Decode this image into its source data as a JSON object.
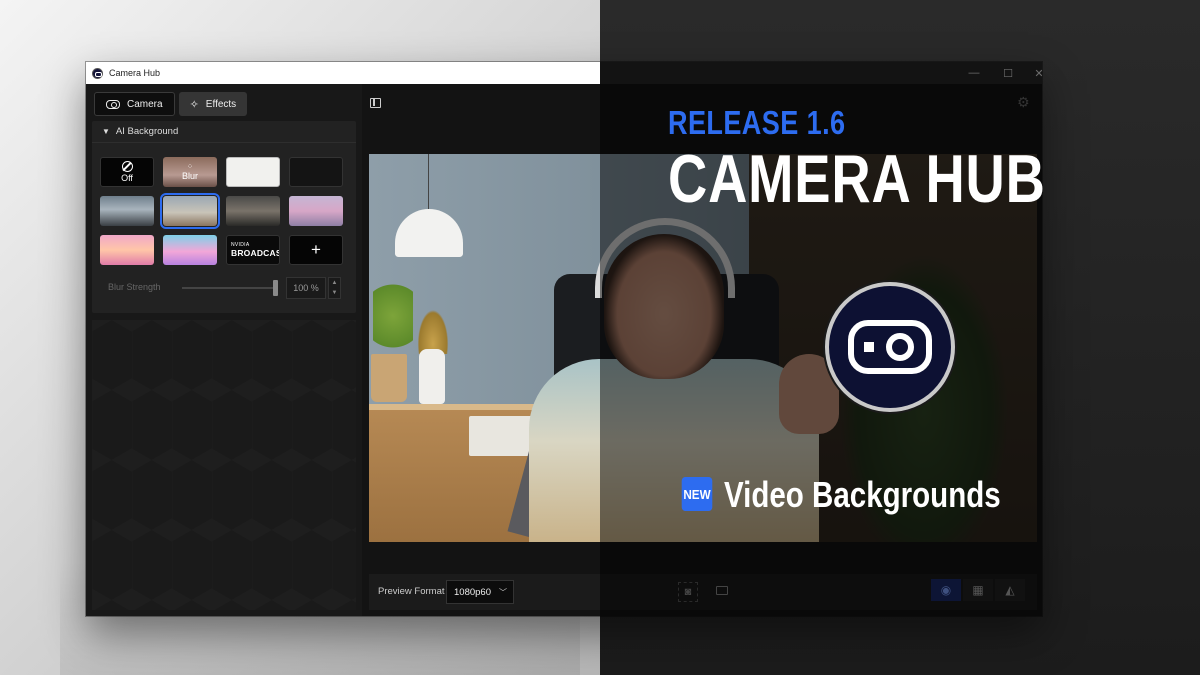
{
  "window": {
    "title": "Camera Hub",
    "controls": {
      "minimize": "—",
      "maximize": "☐",
      "close": "✕"
    }
  },
  "tabs": [
    {
      "label": "Camera",
      "active": true
    },
    {
      "label": "Effects",
      "active": false
    }
  ],
  "ai_background": {
    "header": "AI Background",
    "tiles": [
      {
        "label": "Off"
      },
      {
        "label": "Blur"
      },
      {
        "label": ""
      },
      {
        "label": ""
      },
      {
        "label": ""
      },
      {
        "label": "",
        "selected": true
      },
      {
        "label": ""
      },
      {
        "label": ""
      },
      {
        "label": ""
      },
      {
        "label": ""
      },
      {
        "label_small": "NVIDIA",
        "label": "BROADCAST"
      },
      {
        "label": "+"
      }
    ],
    "blur_strength": {
      "label": "Blur Strength",
      "value": "100 %",
      "fraction": 1.0
    }
  },
  "preview": {
    "format_label": "Preview Format",
    "format_value": "1080p60"
  },
  "promo": {
    "release": "RELEASE 1.6",
    "headline": "CAMERA HUB",
    "badge": "NEW",
    "feature": "Video Backgrounds"
  },
  "colors": {
    "accent": "#2d6cf0",
    "window_bg": "#141414",
    "panel_bg": "#222222"
  }
}
